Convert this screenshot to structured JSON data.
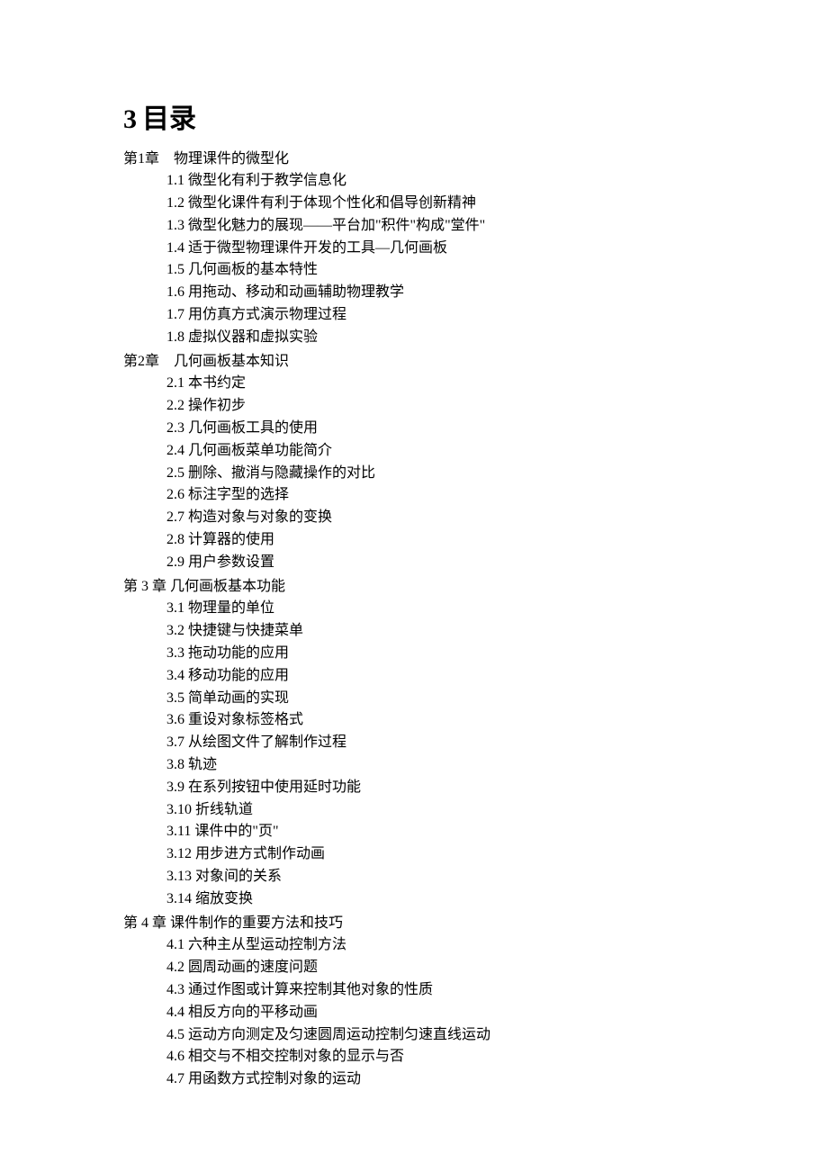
{
  "title_num": "3",
  "title_text": "目录",
  "chapters": [
    {
      "title": "第1章　物理课件的微型化",
      "sections": [
        "1.1 微型化有利于教学信息化",
        "1.2 微型化课件有利于体现个性化和倡导创新精神",
        "1.3 微型化魅力的展现——平台加\"积件\"构成\"堂件\"",
        "1.4 适于微型物理课件开发的工具—几何画板",
        "1.5 几何画板的基本特性",
        "1.6 用拖动、移动和动画辅助物理教学",
        "1.7 用仿真方式演示物理过程",
        "1.8 虚拟仪器和虚拟实验"
      ]
    },
    {
      "title": "第2章　几何画板基本知识",
      "sections": [
        "2.1  本书约定",
        "2.2  操作初步",
        "2.3  几何画板工具的使用",
        "2.4 几何画板菜单功能简介",
        "2.5  删除、撤消与隐藏操作的对比",
        "2.6  标注字型的选择",
        "2.7  构造对象与对象的变换",
        "2.8  计算器的使用",
        "2.9  用户参数设置"
      ]
    },
    {
      "title": "第 3 章  几何画板基本功能",
      "sections": [
        "3.1 物理量的单位",
        "3.2 快捷键与快捷菜单",
        "3.3 拖动功能的应用",
        "3.4 移动功能的应用",
        "3.5 简单动画的实现",
        "3.6 重设对象标签格式",
        "3.7 从绘图文件了解制作过程",
        "3.8 轨迹",
        "3.9 在系列按钮中使用延时功能",
        "3.10 折线轨道",
        "3.11 课件中的\"页\"",
        "3.12 用步进方式制作动画",
        "3.13 对象间的关系",
        "3.14  缩放变换"
      ]
    },
    {
      "title": "第 4 章  课件制作的重要方法和技巧",
      "sections": [
        "4.1 六种主从型运动控制方法",
        "4.2 圆周动画的速度问题",
        "4.3 通过作图或计算来控制其他对象的性质",
        "4.4 相反方向的平移动画",
        "4.5 运动方向测定及匀速圆周运动控制匀速直线运动",
        "4.6 相交与不相交控制对象的显示与否",
        "4.7 用函数方式控制对象的运动"
      ]
    }
  ]
}
